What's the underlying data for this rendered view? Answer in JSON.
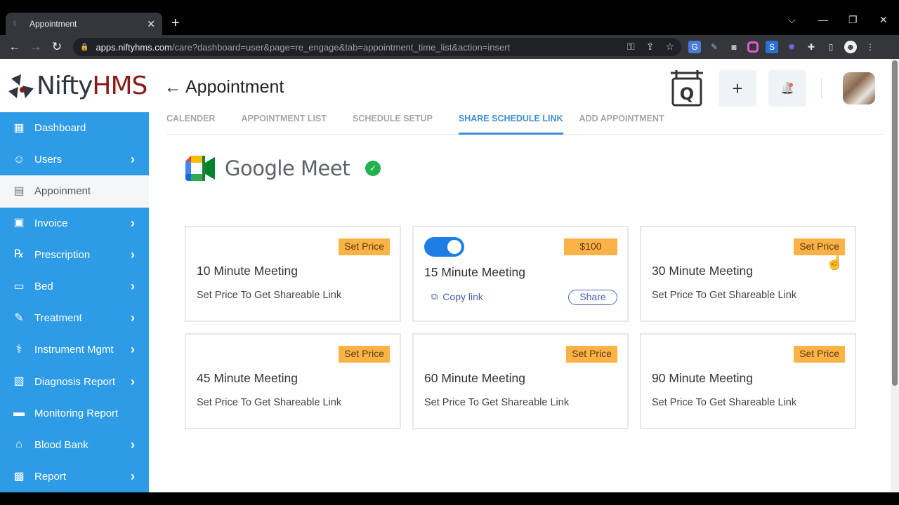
{
  "browser": {
    "tab_title": "Appointment",
    "new_tab": "+",
    "url_host": "apps.niftyhms.com",
    "url_path": "/care?dashboard=user&page=re_engage&tab=appointment_time_list&action=insert",
    "window_controls": [
      "⌵",
      "—",
      "❐",
      "✕"
    ]
  },
  "logo": {
    "nifty": "Nifty",
    "hms": "HMS"
  },
  "sidebar": {
    "items": [
      {
        "label": "Dashboard",
        "icon": "grid-icon",
        "glyph": "▦",
        "chevron": false,
        "active": false
      },
      {
        "label": "Users",
        "icon": "users-icon",
        "glyph": "☺",
        "chevron": true,
        "active": false
      },
      {
        "label": "Appoinment",
        "icon": "calendar-icon",
        "glyph": "▤",
        "chevron": false,
        "active": true
      },
      {
        "label": "Invoice",
        "icon": "invoice-icon",
        "glyph": "▣",
        "chevron": true,
        "active": false
      },
      {
        "label": "Prescription",
        "icon": "prescription-icon",
        "glyph": "℞",
        "chevron": true,
        "active": false
      },
      {
        "label": "Bed",
        "icon": "bed-icon",
        "glyph": "▭",
        "chevron": true,
        "active": false
      },
      {
        "label": "Treatment",
        "icon": "treatment-icon",
        "glyph": "✎",
        "chevron": true,
        "active": false
      },
      {
        "label": "Instrument Mgmt",
        "icon": "stethoscope-icon",
        "glyph": "⚕",
        "chevron": true,
        "active": false
      },
      {
        "label": "Diagnosis Report",
        "icon": "diagnosis-icon",
        "glyph": "▧",
        "chevron": true,
        "active": false
      },
      {
        "label": "Monitoring Report",
        "icon": "monitor-icon",
        "glyph": "▬",
        "chevron": false,
        "active": false
      },
      {
        "label": "Blood Bank",
        "icon": "bank-icon",
        "glyph": "⌂",
        "chevron": true,
        "active": false
      },
      {
        "label": "Report",
        "icon": "report-icon",
        "glyph": "▩",
        "chevron": true,
        "active": false
      }
    ],
    "chevron_glyph": "›"
  },
  "header": {
    "back": "←",
    "title": "Appointment",
    "add": "+",
    "bell": "🔔"
  },
  "tabs": [
    {
      "label": "CALENDER",
      "active": false
    },
    {
      "label": "APPOINTMENT LIST",
      "active": false
    },
    {
      "label": "SCHEDULE SETUP",
      "active": false
    },
    {
      "label": "SHARE SCHEDULE LINK",
      "active": true
    },
    {
      "label": "ADD APPOINTMENT",
      "active": false
    }
  ],
  "integration": {
    "name": "Google Meet",
    "connected": "✓"
  },
  "cards": [
    {
      "title": "10 Minute Meeting",
      "price_label": "Set Price",
      "subtitle": "Set Price To Get Shareable Link",
      "enabled": false
    },
    {
      "title": "15 Minute Meeting",
      "price_label": "$100",
      "enabled": true,
      "toggle_on": true,
      "copy_label": "Copy link",
      "share_label": "Share"
    },
    {
      "title": "30 Minute Meeting",
      "price_label": "Set Price",
      "subtitle": "Set Price To Get Shareable Link",
      "enabled": false
    },
    {
      "title": "45 Minute Meeting",
      "price_label": "Set Price",
      "subtitle": "Set Price To Get Shareable Link",
      "enabled": false
    },
    {
      "title": "60 Minute Meeting",
      "price_label": "Set Price",
      "subtitle": "Set Price To Get Shareable Link",
      "enabled": false
    },
    {
      "title": "90 Minute Meeting",
      "price_label": "Set Price",
      "subtitle": "Set Price To Get Shareable Link",
      "enabled": false
    }
  ],
  "colors": {
    "sidebar": "#2d9be6",
    "accent": "#3b8fd6",
    "price": "#fbb246",
    "toggle": "#1e7ee6",
    "success": "#22b14c"
  }
}
